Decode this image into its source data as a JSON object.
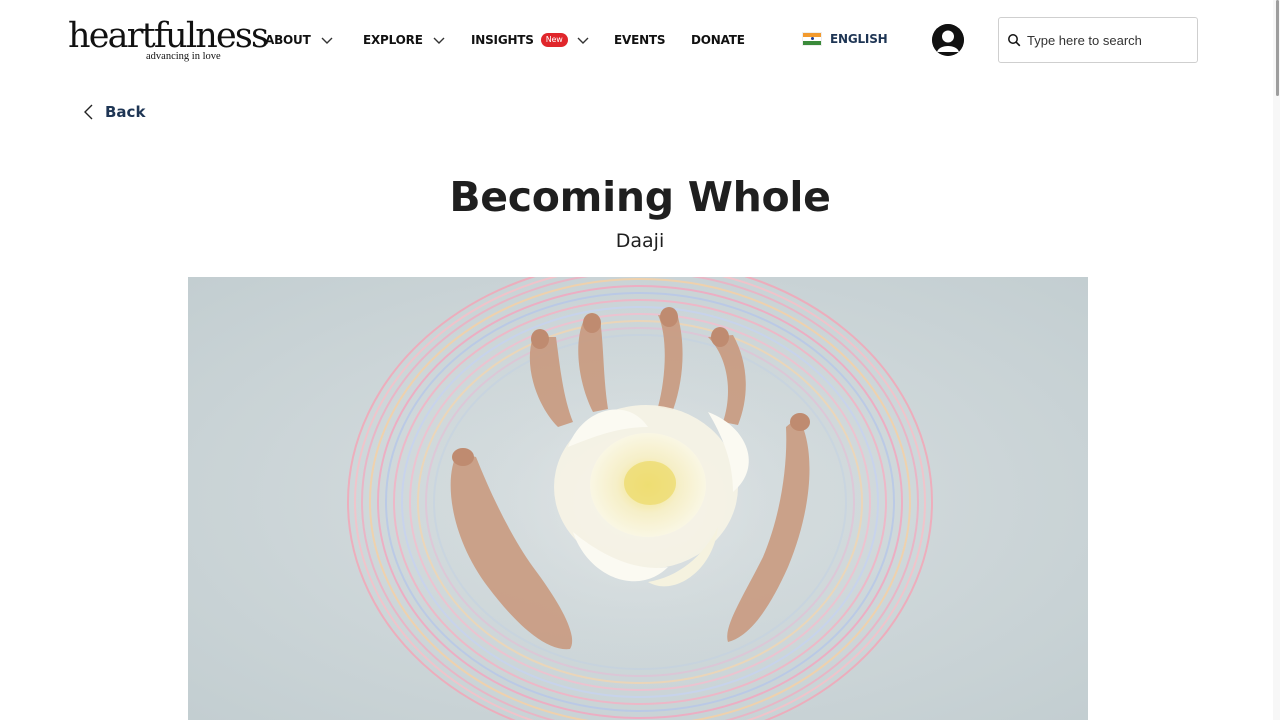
{
  "brand": {
    "logo_word": "heartfulness",
    "logo_tagline": "advancing in love"
  },
  "nav": {
    "about": "ABOUT",
    "explore": "EXPLORE",
    "insights": "INSIGHTS",
    "insights_badge": "New",
    "events": "EVENTS",
    "donate": "DONATE"
  },
  "language": {
    "label": "ENGLISH",
    "flag": "india-flag-icon"
  },
  "search": {
    "placeholder": "Type here to search",
    "value": ""
  },
  "back": {
    "label": "Back"
  },
  "article": {
    "title": "Becoming Whole",
    "author": "Daaji",
    "hero_image": "hands-holding-white-flower-in-water-with-colorful-rings"
  },
  "colors": {
    "accent": "#1e3554",
    "badge": "#e0262b",
    "hero_background": "#c9d3d6"
  },
  "icons": {
    "search": "search-icon",
    "back": "chevron-left-icon",
    "dropdown": "chevron-down-icon",
    "user": "user-avatar-icon"
  }
}
